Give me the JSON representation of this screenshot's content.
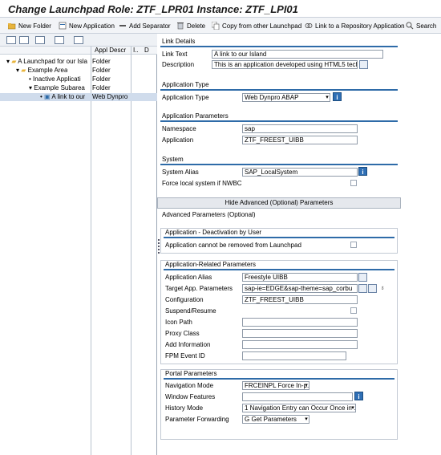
{
  "window": {
    "title": "Change Launchpad Role: ZTF_LPR01 Instance: ZTF_LPI01"
  },
  "toolbar": {
    "new_folder": "New Folder",
    "new_application": "New Application",
    "add_separator": "Add Separator",
    "delete": "Delete",
    "copy_from": "Copy from other Launchpad",
    "link_repository": "Link to a Repository Application",
    "search": "Search"
  },
  "tree": {
    "headers": {
      "appl_descr": "Appl Descr",
      "i": "I..",
      "d": "D"
    },
    "rows": [
      {
        "name": "A Launchpad for our Isla",
        "descr": "Folder"
      },
      {
        "name": "Example Area",
        "descr": "Folder"
      },
      {
        "name": "Inactive Applicati",
        "descr": "Folder"
      },
      {
        "name": "Example Subarea",
        "descr": "Folder"
      },
      {
        "name": "A link to our",
        "descr": "Web Dynpro"
      }
    ]
  },
  "link_details": {
    "title": "Link Details",
    "link_text_label": "Link Text",
    "link_text": "A link to our Island",
    "description_label": "Description",
    "description": "This is an application developed using HTML5 techn"
  },
  "application_type": {
    "title": "Application Type",
    "label": "Application Type",
    "value": "Web Dynpro ABAP"
  },
  "application_parameters": {
    "title": "Application Parameters",
    "namespace_label": "Namespace",
    "namespace": "sap",
    "application_label": "Application",
    "application": "ZTF_FREEST_UIBB"
  },
  "system": {
    "title": "System",
    "alias_label": "System Alias",
    "alias": "SAP_LocalSystem",
    "force_label": "Force local system if NWBC"
  },
  "hide_button": "Hide Advanced (Optional) Parameters",
  "advanced": {
    "title": "Advanced Parameters (Optional)",
    "deactivation": {
      "title": "Application - Deactivation by User",
      "label": "Application cannot be removed from Launchpad"
    },
    "related": {
      "title": "Application-Related Parameters",
      "alias_label": "Application Alias",
      "alias": "Freestyle UIBB",
      "target_label": "Target App. Parameters",
      "target": "sap-ie=EDGE&sap-theme=sap_corbu",
      "config_label": "Configuration",
      "config": "ZTF_FREEST_UIBB",
      "suspend_label": "Suspend/Resume",
      "icon_path_label": "Icon Path",
      "proxy_label": "Proxy Class",
      "add_info_label": "Add Information",
      "fpm_label": "FPM Event ID"
    },
    "portal": {
      "title": "Portal Parameters",
      "nav_mode_label": "Navigation Mode",
      "nav_mode": "FRCEINPL Force In-p...",
      "window_features_label": "Window Features",
      "history_label": "History Mode",
      "history": "1 Navigation Entry can Occur Once in ...",
      "forwarding_label": "Parameter Forwarding",
      "forwarding": "G Get Parameters"
    }
  },
  "colors": {
    "accent": "#2e6ba8",
    "folder": "#e8b43c"
  }
}
